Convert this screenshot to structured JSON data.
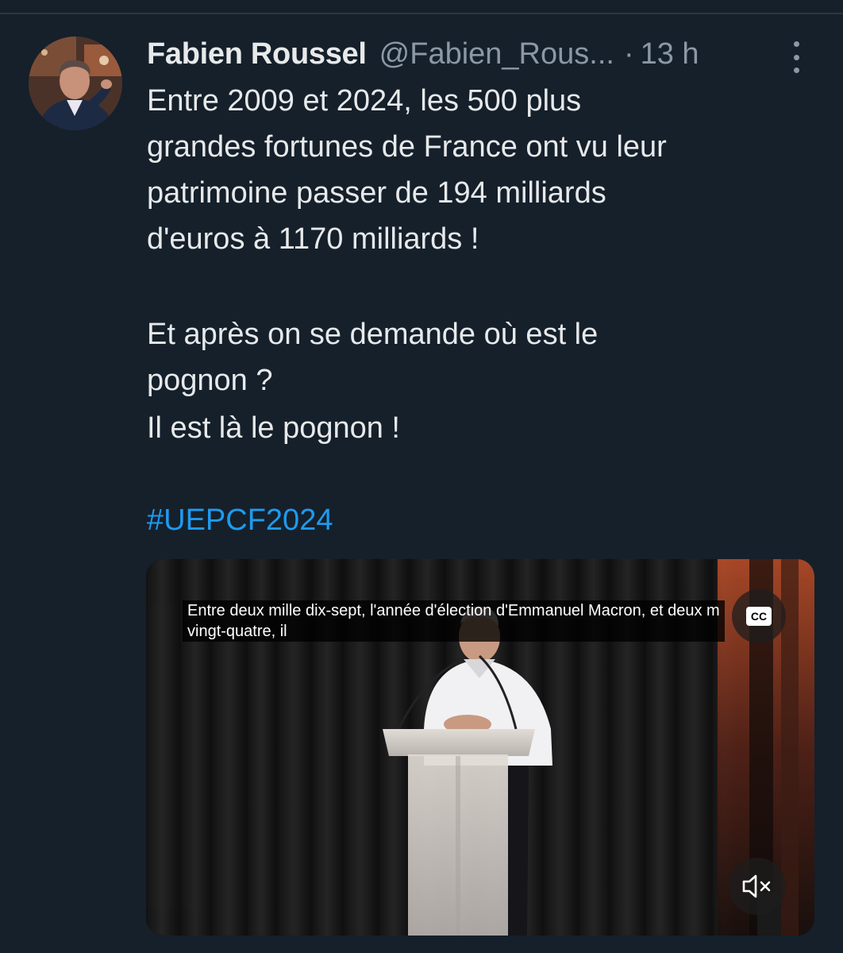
{
  "tweet": {
    "author": {
      "display_name": "Fabien Roussel",
      "handle": "@Fabien_Rous...",
      "separator": "·",
      "time": "13 h"
    },
    "text_lines": [
      "Entre 2009 et 2024, les 500 plus",
      "grandes fortunes de France ont vu leur",
      "patrimoine passer de 194 milliards",
      "d'euros à 1170 milliards !",
      "Et après on se demande où est le",
      "pognon ?",
      "Il est là le pognon !"
    ],
    "hashtag": "#UEPCF2024"
  },
  "video": {
    "caption_lines": [
      "Entre deux mille dix-sept, l'année d'élection d'Emmanuel Macron, et deux m",
      "vingt-quatre, il"
    ],
    "cc_label": "CC"
  },
  "icons": {
    "more": "more-vertical-icon",
    "cc": "closed-captions-icon",
    "mute": "speaker-muted-icon"
  },
  "colors": {
    "background": "#15202b",
    "text": "#e7e9ea",
    "secondary_text": "#8b98a5",
    "link": "#1d9bf0"
  }
}
